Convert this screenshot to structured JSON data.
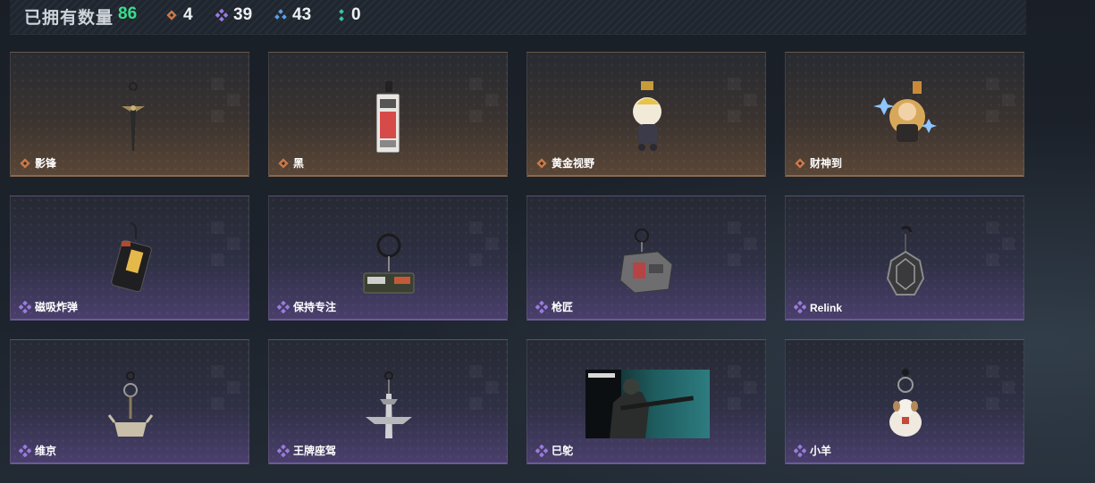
{
  "header": {
    "owned_label": "已拥有数量",
    "owned_count": "86",
    "stats": [
      {
        "icon": "legend-rarity-icon",
        "color": "#c8794a",
        "value": "4"
      },
      {
        "icon": "epic-rarity-icon",
        "color": "#9b7be0",
        "value": "39"
      },
      {
        "icon": "rare-rarity-icon",
        "color": "#5aa0e6",
        "value": "43"
      },
      {
        "icon": "common-rarity-icon",
        "color": "#36c7a0",
        "value": "0"
      }
    ]
  },
  "colors": {
    "legend": "#c8794a",
    "epic": "#9b7be0",
    "accent_green": "#37e08c"
  },
  "items": [
    {
      "name": "影锋",
      "rarity": "legend",
      "icon": "blade-charm-icon"
    },
    {
      "name": "黑",
      "rarity": "legend",
      "icon": "tag-charm-icon"
    },
    {
      "name": "黄金视野",
      "rarity": "legend",
      "icon": "figure-charm-icon"
    },
    {
      "name": "财神到",
      "rarity": "legend",
      "icon": "fortune-figure-charm-icon"
    },
    {
      "name": "磁吸炸弹",
      "rarity": "epic",
      "icon": "bomb-charm-icon"
    },
    {
      "name": "保持专注",
      "rarity": "epic",
      "icon": "patch-charm-icon"
    },
    {
      "name": "枪匠",
      "rarity": "epic",
      "icon": "badge-charm-icon"
    },
    {
      "name": "Relink",
      "rarity": "epic",
      "icon": "turtle-shell-charm-icon"
    },
    {
      "name": "维京",
      "rarity": "epic",
      "icon": "viking-helmet-charm-icon"
    },
    {
      "name": "王牌座驾",
      "rarity": "epic",
      "icon": "jet-plane-charm-icon"
    },
    {
      "name": "巳鸵",
      "rarity": "epic",
      "icon": "soldier-card-image"
    },
    {
      "name": "小羊",
      "rarity": "epic",
      "icon": "sheep-charm-icon"
    }
  ]
}
